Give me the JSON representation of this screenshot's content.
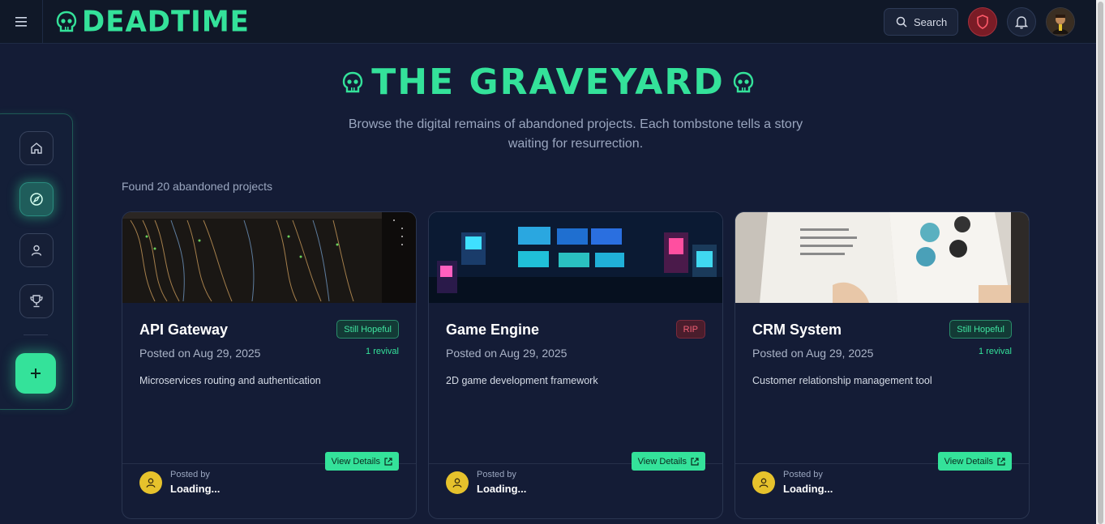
{
  "app": {
    "name": "DEADTIME"
  },
  "header": {
    "search_label": "Search"
  },
  "hero": {
    "title": "THE GRAVEYARD",
    "subtitle": "Browse the digital remains of abandoned projects. Each tombstone tells a story waiting for resurrection."
  },
  "results": {
    "found_text": "Found 20 abandoned projects"
  },
  "dock": {
    "items": [
      {
        "icon": "home-icon"
      },
      {
        "icon": "compass-icon",
        "active": true
      },
      {
        "icon": "user-icon"
      },
      {
        "icon": "trophy-icon"
      }
    ],
    "add_icon": "plus-icon"
  },
  "cards": [
    {
      "title": "API Gateway",
      "badge": "Still Hopeful",
      "posted": "Posted on Aug 29, 2025",
      "revival": "1 revival",
      "description": "Microservices routing and authentication",
      "view_label": "View Details",
      "posted_by_label": "Posted by",
      "poster": "Loading..."
    },
    {
      "title": "Game Engine",
      "badge": "RIP",
      "posted": "Posted on Aug 29, 2025",
      "revival": "",
      "description": "2D game development framework",
      "view_label": "View Details",
      "posted_by_label": "Posted by",
      "poster": "Loading..."
    },
    {
      "title": "CRM System",
      "badge": "Still Hopeful",
      "posted": "Posted on Aug 29, 2025",
      "revival": "1 revival",
      "description": "Customer relationship management tool",
      "view_label": "View Details",
      "posted_by_label": "Posted by",
      "poster": "Loading..."
    }
  ],
  "colors": {
    "accent": "#34e29a",
    "background": "#141c36",
    "rip": "#f06075"
  }
}
